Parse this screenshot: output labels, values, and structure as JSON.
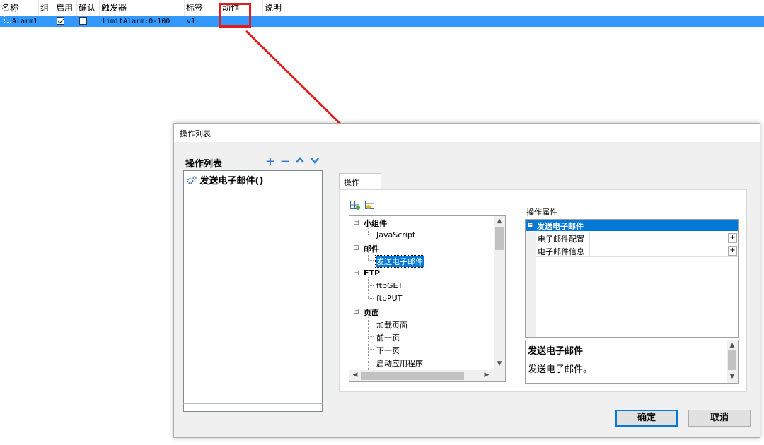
{
  "top_table": {
    "columns": [
      "名称",
      "组",
      "启用",
      "确认",
      "触发器",
      "标签",
      "动作",
      "说明"
    ],
    "row": {
      "name": "Alarm1",
      "enabled": true,
      "confirm": false,
      "trigger": "limitAlarm:0-100",
      "tag": "v1"
    }
  },
  "dialog": {
    "title": "操作列表",
    "list_label": "操作列表",
    "toolbar": {
      "add": "+",
      "remove": "−",
      "up": "∧",
      "down": "∨"
    },
    "list_items": [
      "发送电子邮件()"
    ],
    "tab_label": "操作",
    "tree": {
      "groups": [
        {
          "label": "小组件",
          "children": [
            "JavaScript"
          ]
        },
        {
          "label": "邮件",
          "children": [
            "发送电子邮件"
          ]
        },
        {
          "label": "FTP",
          "children": [
            "ftpGET",
            "ftpPUT"
          ]
        },
        {
          "label": "页面",
          "children": [
            "加载页面",
            "前一页",
            "下一页",
            "启动应用程序"
          ]
        }
      ],
      "selected": "发送电子邮件"
    },
    "properties": {
      "label": "操作属性",
      "category": "发送电子邮件",
      "rows": [
        "电子邮件配置",
        "电子邮件信息"
      ]
    },
    "description": {
      "title": "发送电子邮件",
      "text": "发送电子邮件。"
    },
    "buttons": {
      "ok": "确定",
      "cancel": "取消"
    }
  },
  "colors": {
    "selection": "#3399ff",
    "annotation": "#e51b1b",
    "accent": "#0078d7"
  }
}
